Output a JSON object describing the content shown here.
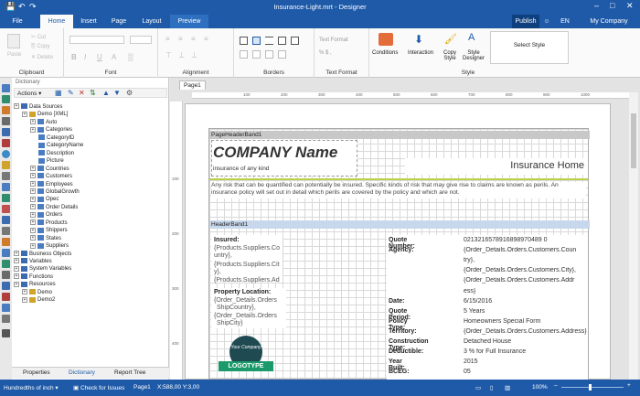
{
  "window": {
    "title": "Insurance-Light.mrt - Designer"
  },
  "menu_tabs": [
    "File",
    "Home",
    "Insert",
    "Page",
    "Layout",
    "Preview"
  ],
  "topright": {
    "publish": "Publish",
    "lang": "EN",
    "account": "My Company"
  },
  "ribbon": {
    "clipboard": {
      "label": "Clipboard",
      "paste": "Paste",
      "cut": "Cut",
      "copy": "Copy",
      "delete": "Delete"
    },
    "font": {
      "label": "Font"
    },
    "alignment": {
      "label": "Alignment"
    },
    "borders": {
      "label": "Borders"
    },
    "text_format": {
      "label": "Text Format",
      "button": "Text Format"
    },
    "style": {
      "label": "Style",
      "conditions": "Conditions",
      "interaction": "Interaction",
      "copy_style": "Copy Style",
      "style_designer": "Style Designer",
      "select_style": "Select Style"
    }
  },
  "dictionary": {
    "header": "Dictionary",
    "actions": "Actions",
    "tree": [
      {
        "label": "Data Sources",
        "level": 0
      },
      {
        "label": "Demo [XML]",
        "level": 1
      },
      {
        "label": "Auto",
        "level": 2
      },
      {
        "label": "Categories",
        "level": 2
      },
      {
        "label": "CategoryID",
        "level": 3
      },
      {
        "label": "CategoryName",
        "level": 3
      },
      {
        "label": "Description",
        "level": 3
      },
      {
        "label": "Picture",
        "level": 3
      },
      {
        "label": "Countries",
        "level": 2
      },
      {
        "label": "Customers",
        "level": 2
      },
      {
        "label": "Employees",
        "level": 2
      },
      {
        "label": "GlobalGrowth",
        "level": 2
      },
      {
        "label": "Opec",
        "level": 2
      },
      {
        "label": "Order Details",
        "level": 2
      },
      {
        "label": "Orders",
        "level": 2
      },
      {
        "label": "Products",
        "level": 2
      },
      {
        "label": "Shippers",
        "level": 2
      },
      {
        "label": "States",
        "level": 2
      },
      {
        "label": "Suppliers",
        "level": 2
      },
      {
        "label": "Business Objects",
        "level": 0
      },
      {
        "label": "Variables",
        "level": 0
      },
      {
        "label": "System Variables",
        "level": 0
      },
      {
        "label": "Functions",
        "level": 0
      },
      {
        "label": "Resources",
        "level": 0
      },
      {
        "label": "Demo",
        "level": 1
      },
      {
        "label": "Demo2",
        "level": 1
      }
    ]
  },
  "bottom_tabs": [
    "Properties",
    "Dictionary",
    "Report Tree"
  ],
  "page_tab": "Page1",
  "ruler_h": [
    "100",
    "200",
    "300",
    "400",
    "500",
    "600",
    "700",
    "800",
    "900",
    "1000"
  ],
  "ruler_v": [
    "100",
    "200",
    "300",
    "400"
  ],
  "report": {
    "page_header_band": "PageHeaderBand1",
    "company_name": "COMPANY Name",
    "tagline": "insurance of any kind",
    "title": "Insurance Home",
    "intro": "Any risk that can be quantified can potentially be insured. Specific kinds of risk that may give rise to claims are known as perils. An insurance policy will set out in detail which perils are covered by the policy and which are not.",
    "header_band": "HeaderBand1",
    "insured_label": "Insured:",
    "insured_lines": [
      "{Products.Suppliers.Co",
      "untry},",
      "{Products.Suppliers.Cit",
      "y},",
      "{Products.Suppliers.Ad"
    ],
    "property_label": "Property Location:",
    "property_lines": [
      "{Order_Details.Orders",
      "ShipCountry},",
      "{Order_Details.Orders",
      "ShipCity}"
    ],
    "logo_top": "Your Company",
    "logo_text": "LOGOTYPE",
    "fields": [
      {
        "label": "Quote Number:",
        "value": "0213216578916898970489 0"
      },
      {
        "label": "Agency:",
        "value": "{Order_Details.Orders.Customers.Coun"
      },
      {
        "label": "",
        "value": "try},"
      },
      {
        "label": "",
        "value": "{Order_Details.Orders.Customers.City},"
      },
      {
        "label": "",
        "value": "{Order_Details.Orders.Customers.Addr"
      },
      {
        "label": "",
        "value": "ess}"
      },
      {
        "label": "Date:",
        "value": "6/15/2016"
      },
      {
        "label": "Quote Period:",
        "value": "5 Years"
      },
      {
        "label": "Policy Type:",
        "value": "Homeowners Special Form"
      },
      {
        "label": "Territory:",
        "value": "{Order_Details.Orders.Customers.Address}"
      },
      {
        "label": "Construction Type:",
        "value": "Detached House"
      },
      {
        "label": "Deductible:",
        "value": "3 % for Full Insurance"
      },
      {
        "label": "Year Built:",
        "value": "2015"
      },
      {
        "label": "BCEG:",
        "value": "05"
      }
    ]
  },
  "status": {
    "units": "Hundredths of inch",
    "check": "Check for Issues",
    "page": "Page1",
    "coords": "X:588,00 Y:3,00",
    "zoom": "100%"
  },
  "colors": {
    "accent": "#1e5aa8",
    "band": "#c8c8c8",
    "header_band": "#c8d8ec",
    "logo": "#1f4a52",
    "ribbon_green": "#1a9a6a"
  }
}
